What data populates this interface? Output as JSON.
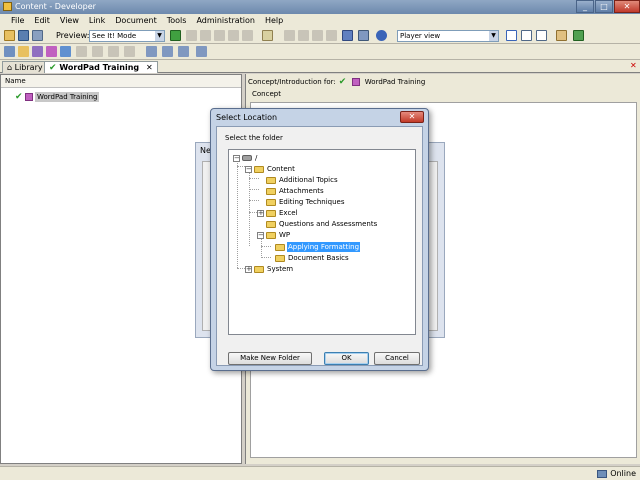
{
  "window": {
    "title": "Content - Developer"
  },
  "menu": [
    "File",
    "Edit",
    "View",
    "Link",
    "Document",
    "Tools",
    "Administration",
    "Help"
  ],
  "toolbar": {
    "preview_label": "Preview:",
    "preview_mode": "See It! Mode",
    "player_view": "Player view"
  },
  "tabs": [
    {
      "label": "Library"
    },
    {
      "label": "WordPad Training"
    }
  ],
  "left_pane": {
    "column_header": "Name",
    "root_item": "WordPad Training"
  },
  "right_pane": {
    "title_prefix": "Concept/Introduction for:",
    "title_doc": "WordPad Training",
    "concept_label": "Concept"
  },
  "behind_dialog": {
    "title_fragment": "Ne"
  },
  "dialog": {
    "title": "Select Location",
    "close_glyph": "✕",
    "instruction": "Select the folder",
    "tree": {
      "root": "/",
      "content": "Content",
      "children": [
        "Additional Topics",
        "Attachments",
        "Editing Techniques",
        "Excel",
        "Questions and Assessments",
        "WP"
      ],
      "wp_children": [
        "Applying Formatting",
        "Document Basics"
      ],
      "system": "System",
      "selected": "Applying Formatting"
    },
    "buttons": {
      "make_new_folder": "Make New Folder",
      "ok": "OK",
      "cancel": "Cancel"
    }
  },
  "status": {
    "online": "Online"
  }
}
